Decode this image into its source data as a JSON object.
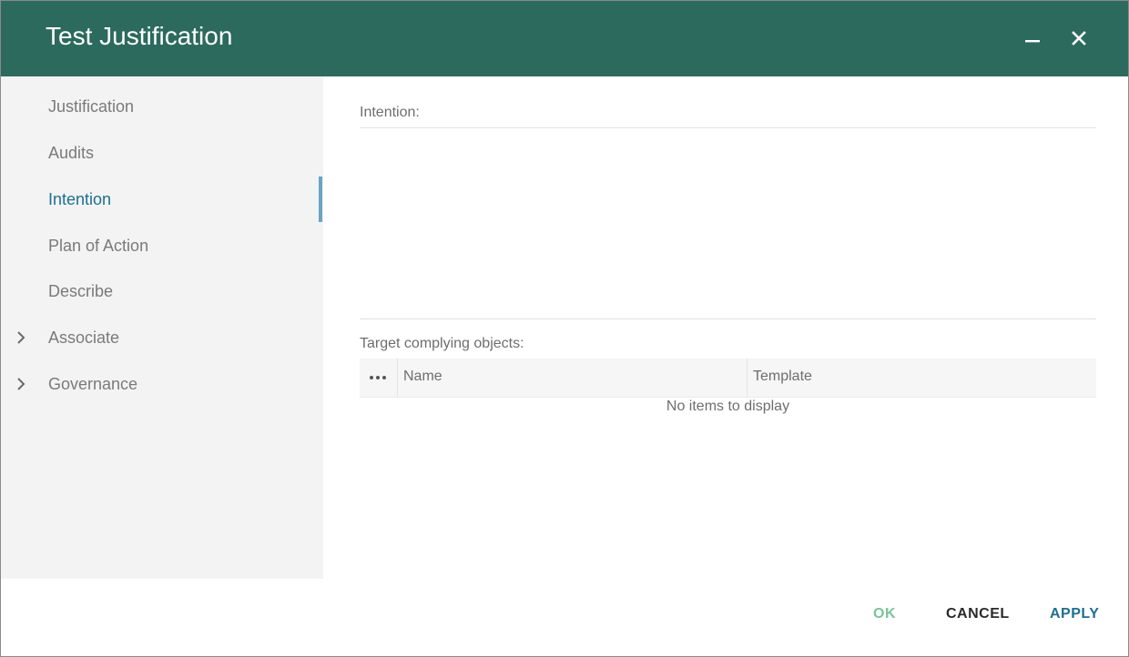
{
  "window": {
    "title": "Test Justification",
    "minimize_icon": "minimize-icon",
    "close_icon": "close-icon",
    "header_color": "#2c6a5e"
  },
  "sidebar": {
    "active_color": "#1f6e92",
    "items": [
      {
        "label": "Justification",
        "active": false,
        "expandable": false
      },
      {
        "label": "Audits",
        "active": false,
        "expandable": false
      },
      {
        "label": "Intention",
        "active": true,
        "expandable": false
      },
      {
        "label": "Plan of Action",
        "active": false,
        "expandable": false
      },
      {
        "label": "Describe",
        "active": false,
        "expandable": false
      },
      {
        "label": "Associate",
        "active": false,
        "expandable": true,
        "icon": "chevron-right-icon"
      },
      {
        "label": "Governance",
        "active": false,
        "expandable": true,
        "icon": "chevron-right-icon"
      }
    ]
  },
  "main": {
    "intention_label": "Intention:",
    "intention_value": "",
    "target_label": "Target complying objects:",
    "grid": {
      "menu_icon": "more-horizontal-icon",
      "columns": [
        "Name",
        "Template"
      ],
      "rows": [],
      "empty_message": "No items to display"
    }
  },
  "footer": {
    "ok_label": "OK",
    "cancel_label": "CANCEL",
    "apply_label": "APPLY"
  }
}
